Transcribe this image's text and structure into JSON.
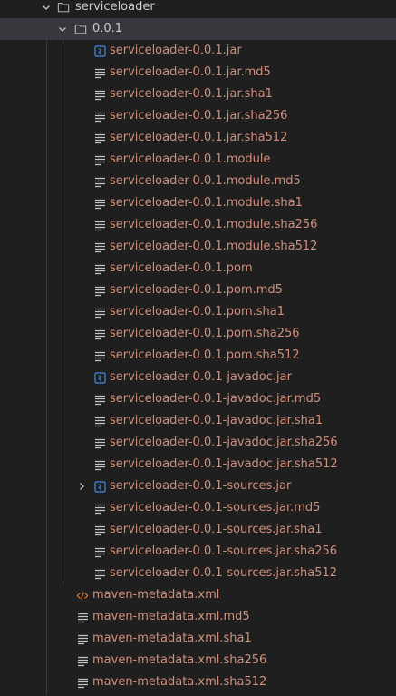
{
  "tree": {
    "root_folder": {
      "label": "serviceloader",
      "expanded": true
    },
    "version_folder": {
      "label": "0.0.1",
      "expanded": true
    },
    "version_files": [
      {
        "label": "serviceloader-0.0.1.jar",
        "icon": "jar-archive-icon"
      },
      {
        "label": "serviceloader-0.0.1.jar.md5",
        "icon": "text-file-icon"
      },
      {
        "label": "serviceloader-0.0.1.jar.sha1",
        "icon": "text-file-icon"
      },
      {
        "label": "serviceloader-0.0.1.jar.sha256",
        "icon": "text-file-icon"
      },
      {
        "label": "serviceloader-0.0.1.jar.sha512",
        "icon": "text-file-icon"
      },
      {
        "label": "serviceloader-0.0.1.module",
        "icon": "text-file-icon"
      },
      {
        "label": "serviceloader-0.0.1.module.md5",
        "icon": "text-file-icon"
      },
      {
        "label": "serviceloader-0.0.1.module.sha1",
        "icon": "text-file-icon"
      },
      {
        "label": "serviceloader-0.0.1.module.sha256",
        "icon": "text-file-icon"
      },
      {
        "label": "serviceloader-0.0.1.module.sha512",
        "icon": "text-file-icon"
      },
      {
        "label": "serviceloader-0.0.1.pom",
        "icon": "text-file-icon"
      },
      {
        "label": "serviceloader-0.0.1.pom.md5",
        "icon": "text-file-icon"
      },
      {
        "label": "serviceloader-0.0.1.pom.sha1",
        "icon": "text-file-icon"
      },
      {
        "label": "serviceloader-0.0.1.pom.sha256",
        "icon": "text-file-icon"
      },
      {
        "label": "serviceloader-0.0.1.pom.sha512",
        "icon": "text-file-icon"
      },
      {
        "label": "serviceloader-0.0.1-javadoc.jar",
        "icon": "jar-archive-icon"
      },
      {
        "label": "serviceloader-0.0.1-javadoc.jar.md5",
        "icon": "text-file-icon"
      },
      {
        "label": "serviceloader-0.0.1-javadoc.jar.sha1",
        "icon": "text-file-icon"
      },
      {
        "label": "serviceloader-0.0.1-javadoc.jar.sha256",
        "icon": "text-file-icon"
      },
      {
        "label": "serviceloader-0.0.1-javadoc.jar.sha512",
        "icon": "text-file-icon"
      },
      {
        "label": "serviceloader-0.0.1-sources.jar",
        "icon": "jar-archive-icon",
        "collapsed": true
      },
      {
        "label": "serviceloader-0.0.1-sources.jar.md5",
        "icon": "text-file-icon"
      },
      {
        "label": "serviceloader-0.0.1-sources.jar.sha1",
        "icon": "text-file-icon"
      },
      {
        "label": "serviceloader-0.0.1-sources.jar.sha256",
        "icon": "text-file-icon"
      },
      {
        "label": "serviceloader-0.0.1-sources.jar.sha512",
        "icon": "text-file-icon"
      }
    ],
    "metadata_files": [
      {
        "label": "maven-metadata.xml",
        "icon": "xml-code-icon"
      },
      {
        "label": "maven-metadata.xml.md5",
        "icon": "text-file-icon"
      },
      {
        "label": "maven-metadata.xml.sha1",
        "icon": "text-file-icon"
      },
      {
        "label": "maven-metadata.xml.sha256",
        "icon": "text-file-icon"
      },
      {
        "label": "maven-metadata.xml.sha512",
        "icon": "text-file-icon"
      }
    ]
  },
  "colors": {
    "background": "#1f1f1f",
    "selected_row": "#37373d",
    "folder_text": "#cccccc",
    "file_text": "#d18f7b",
    "jar_icon": "#3b8eea",
    "xml_icon": "#e37933",
    "text_icon": "#c5c5c5"
  }
}
